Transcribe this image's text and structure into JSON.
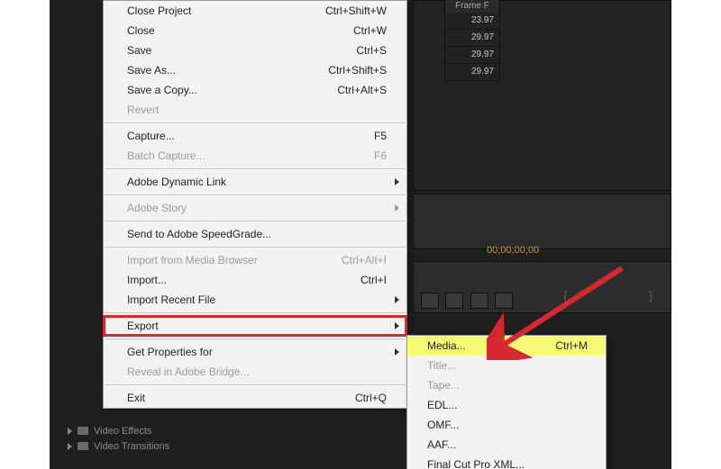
{
  "frame_header": "Frame F",
  "frame_values": [
    "23.97",
    "29.97",
    "29.97",
    "29.97"
  ],
  "timecode": "00;00;00;00",
  "project_tree": {
    "items": [
      "Video Effects",
      "Video Transitions"
    ]
  },
  "file_menu": {
    "groups": [
      [
        {
          "label": "Close Project",
          "shortcut": "Ctrl+Shift+W",
          "enabled": true
        },
        {
          "label": "Close",
          "shortcut": "Ctrl+W",
          "enabled": true
        },
        {
          "label": "Save",
          "shortcut": "Ctrl+S",
          "enabled": true
        },
        {
          "label": "Save As...",
          "shortcut": "Ctrl+Shift+S",
          "enabled": true
        },
        {
          "label": "Save a Copy...",
          "shortcut": "Ctrl+Alt+S",
          "enabled": true
        },
        {
          "label": "Revert",
          "shortcut": "",
          "enabled": false
        }
      ],
      [
        {
          "label": "Capture...",
          "shortcut": "F5",
          "enabled": true
        },
        {
          "label": "Batch Capture...",
          "shortcut": "F6",
          "enabled": false
        }
      ],
      [
        {
          "label": "Adobe Dynamic Link",
          "shortcut": "",
          "enabled": true,
          "submenu": true
        }
      ],
      [
        {
          "label": "Adobe Story",
          "shortcut": "",
          "enabled": false,
          "submenu": true
        }
      ],
      [
        {
          "label": "Send to Adobe SpeedGrade...",
          "shortcut": "",
          "enabled": true
        }
      ],
      [
        {
          "label": "Import from Media Browser",
          "shortcut": "Ctrl+Alt+I",
          "enabled": false
        },
        {
          "label": "Import...",
          "shortcut": "Ctrl+I",
          "enabled": true
        },
        {
          "label": "Import Recent File",
          "shortcut": "",
          "enabled": true,
          "submenu": true
        }
      ],
      [
        {
          "label": "Export",
          "shortcut": "",
          "enabled": true,
          "submenu": true,
          "highlight": "export"
        }
      ],
      [
        {
          "label": "Get Properties for",
          "shortcut": "",
          "enabled": true,
          "submenu": true
        },
        {
          "label": "Reveal in Adobe Bridge...",
          "shortcut": "",
          "enabled": false
        }
      ],
      [
        {
          "label": "Exit",
          "shortcut": "Ctrl+Q",
          "enabled": true
        }
      ]
    ]
  },
  "export_submenu": {
    "items": [
      {
        "label": "Media...",
        "shortcut": "Ctrl+M",
        "enabled": true,
        "highlight": true
      },
      {
        "label": "Title...",
        "shortcut": "",
        "enabled": false
      },
      {
        "label": "Tape...",
        "shortcut": "",
        "enabled": false
      },
      {
        "label": "EDL...",
        "shortcut": "",
        "enabled": true
      },
      {
        "label": "OMF...",
        "shortcut": "",
        "enabled": true
      },
      {
        "label": "AAF...",
        "shortcut": "",
        "enabled": true
      },
      {
        "label": "Final Cut Pro XML...",
        "shortcut": "",
        "enabled": true
      }
    ]
  },
  "colors": {
    "highlight_box": "#d4292f",
    "highlight_row": "#f6f973",
    "timecode": "#c69a46"
  }
}
